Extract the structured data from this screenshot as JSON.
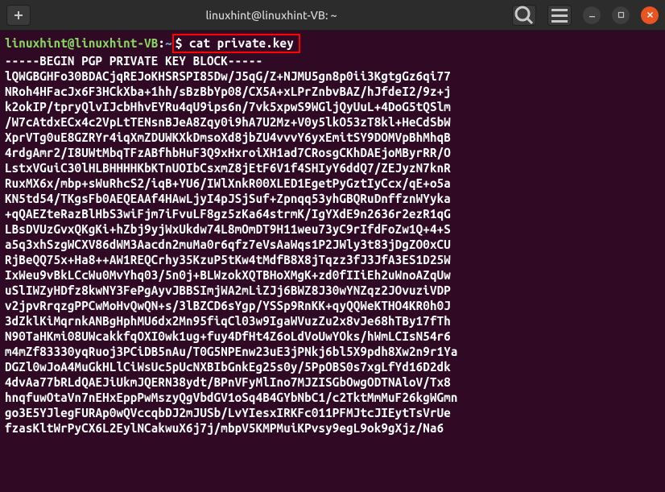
{
  "window": {
    "title": "linuxhint@linuxhint-VB: ~"
  },
  "prompt": {
    "user_host": "linuxhint@linuxhint-VB",
    "colon": ":",
    "path": "~",
    "symbol": "$ ",
    "command": "cat private.key"
  },
  "output": {
    "header": "-----BEGIN PGP PRIVATE KEY BLOCK-----",
    "blank": "",
    "lines": [
      "lQWGBGHFo30BDACjqREJoKHSRSPI85Dw/J5qG/Z+NJMU5gn8p0ii3KgtgGz6qi77",
      "NRoh4HFacJx6F3HCkXba+1hh/sBzBbYp08/CX5A+xLPrZnbvBAZ/hJfdeI2/9z+j",
      "k2okIP/tpryQlvIJcbHhvEYRu4qU9ips6n/7vk5xpwS9WGljQyUuL+4DoG5tQSlm",
      "/W7cAtdxECx4c2VpLtTENsnBJeA8Zqy0i9hA7U2Mz+V0y5lkO53zT8kl+HeCdSbW",
      "XprVTg0uE8GZRYr4iqXmZDUWKXkDmsoXd8jbZU4vvvY6yxEmitSY9DOMVpBhMhqB",
      "4rdgAmr2/I8UWtMbqTFzABfhbHuF3Q9xHxroiXH1ad7CRosgCKhDAEjoMByrRR/O",
      "LstxVGuiC30lHLBHHHHKbKTnUOIbCsxmZ8jEtF6V1f4SHIyY6ddQ7/ZEJyzN7knR",
      "RuxMX6x/mbp+sWuRhcS2/iqB+YU6/IWlXnkR00XLED1EgetPyGztIyCcx/qE+o5a",
      "KN5td54/TKgsFb0AEQEAAf4HAwLjyI4pJSjSuf+Zpnqq53yhGBQRuDnffznWYyka",
      "+qQAEZteRazBlHbS3wiFjm7iFvuLF8gz5zKa64strmK/IgYXdE9n2636r2ezR1qG",
      "LBsDVUzGvxQKgKi+hZbj9yjWxUkdw74L8mOmDT9H11weu73yC9rIfdFoZw1Q+4+S",
      "a5q3xhSzgWCXV86dWM3Aacdn2muMa0r6qfz7eVsAaWqs1P2JWly3t83jDgZO0xCU",
      "RjBeQQ75x+Ha8++AW1REQCrhy35KzuP5tKw4tMdfB8X8jTqzz3fJ3JfA3ES1D25W",
      "IxWeu9vBkLCcWu0MvYhq03/5n0j+BLWzokXQTBHoXMgK+zd0fIIiEh2uWnoAZqUw",
      "uSlIWZyHDfz8kwNY3FePgAyvJBBSImjWA2mLiZJj6BWZ8J30wYNZqz2JOvuziVDP",
      "v2jpvRrqzgPPCwMoHvQwQN+s/3lBZCD6sYgp/YSSp9RnKK+qyQQWeKTHO4KR0h0J",
      "3dZklKiMqrnkANBgHphMU6dx2Mn95fiqCl03w9IgaWVuzZu2x8vJe68hTBy17fTh",
      "N90TaHKmi08UWcakkfqOXI0wk1ug+fuy4DfHt4Z6oLdVoUwYOks/hWmLCIsN54r6",
      "m4mZf83330yqRuoj3PCiDB5nAu/T0G5NPEnw23uE3jPNkj6bl5X9pdh8Xw2n9r1Ya",
      "DGZl0wJoA4MuGkHLlCiWsUc5pUcNXBIbGnkEg25s0y/5PpOBS0s7xgLfYd16D2dk",
      "4dvAa77bRLdQAEJiUkmJQERN38ydt/BPnVFyMlIno7MJZISGbOwgODTNAloV/Tx8",
      "hnqfuwOtaVn7nEHxEppPwMszyQgVbdGV1oSq4B4GYbNbC1/c2TktMmMuF26kgWGmn",
      "go3E5YJlegFURAp0wQVccqbDJ2mJUSb/LvYIesxIRKFc011PFMJtcJIEytTsVrUe",
      "fzasKltWrPyCX6L2EylNCakwuX6j7j/mbpV5KMPMuiKPvsy9egL9ok9gXjz/Na6"
    ]
  }
}
